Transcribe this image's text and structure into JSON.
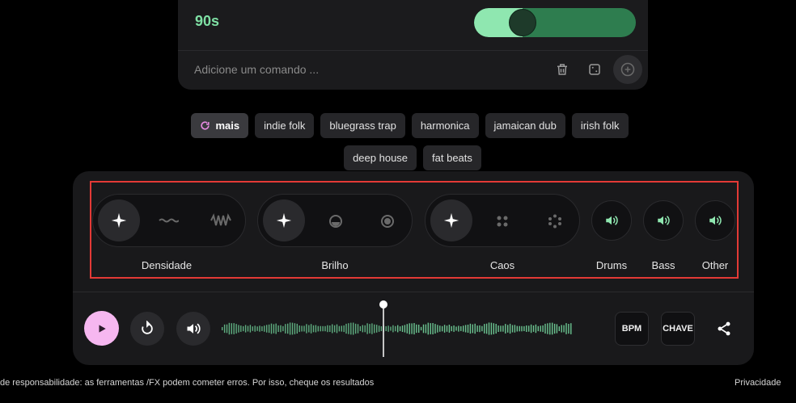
{
  "prompt_card": {
    "name": "90s",
    "weight": 0.3,
    "input_placeholder": "Adicione um comando ...",
    "delete_icon": "trash-icon",
    "random_icon": "dice-icon",
    "add_icon": "plus-circle-icon"
  },
  "chips": {
    "row1": [
      "mais",
      "indie folk",
      "bluegrass trap",
      "harmonica",
      "jamaican dub",
      "irish folk"
    ],
    "row2": [
      "deep house",
      "fat beats"
    ],
    "refresh_icon": "refresh-icon"
  },
  "controls": {
    "density": {
      "label": "Densidade",
      "icons": [
        "sparkle-icon",
        "wave-low-icon",
        "wave-high-icon"
      ]
    },
    "brightness": {
      "label": "Brilho",
      "icons": [
        "sparkle-icon",
        "brightness-low-icon",
        "brightness-high-icon"
      ]
    },
    "chaos": {
      "label": "Caos",
      "icons": [
        "sparkle-icon",
        "dots-grid-icon",
        "dots-scatter-icon"
      ]
    },
    "stems": [
      {
        "label": "Drums",
        "icon": "speaker-icon"
      },
      {
        "label": "Bass",
        "icon": "speaker-icon"
      },
      {
        "label": "Other",
        "icon": "speaker-icon"
      }
    ]
  },
  "transport": {
    "play_icon": "play-icon",
    "reset_icon": "reset-icon",
    "volume_icon": "volume-icon",
    "bpm_label": "BPM",
    "key_label": "CHAVE",
    "share_icon": "share-icon",
    "playhead": 0.5
  },
  "footer": {
    "disclaimer": "de responsabilidade: as ferramentas /FX podem cometer erros. Por isso, cheque os resultados",
    "privacy": "Privacidade"
  },
  "colors": {
    "accent_green": "#7fe0a4",
    "play_pink": "#f6b7f0",
    "highlight_red": "#e33a36"
  }
}
